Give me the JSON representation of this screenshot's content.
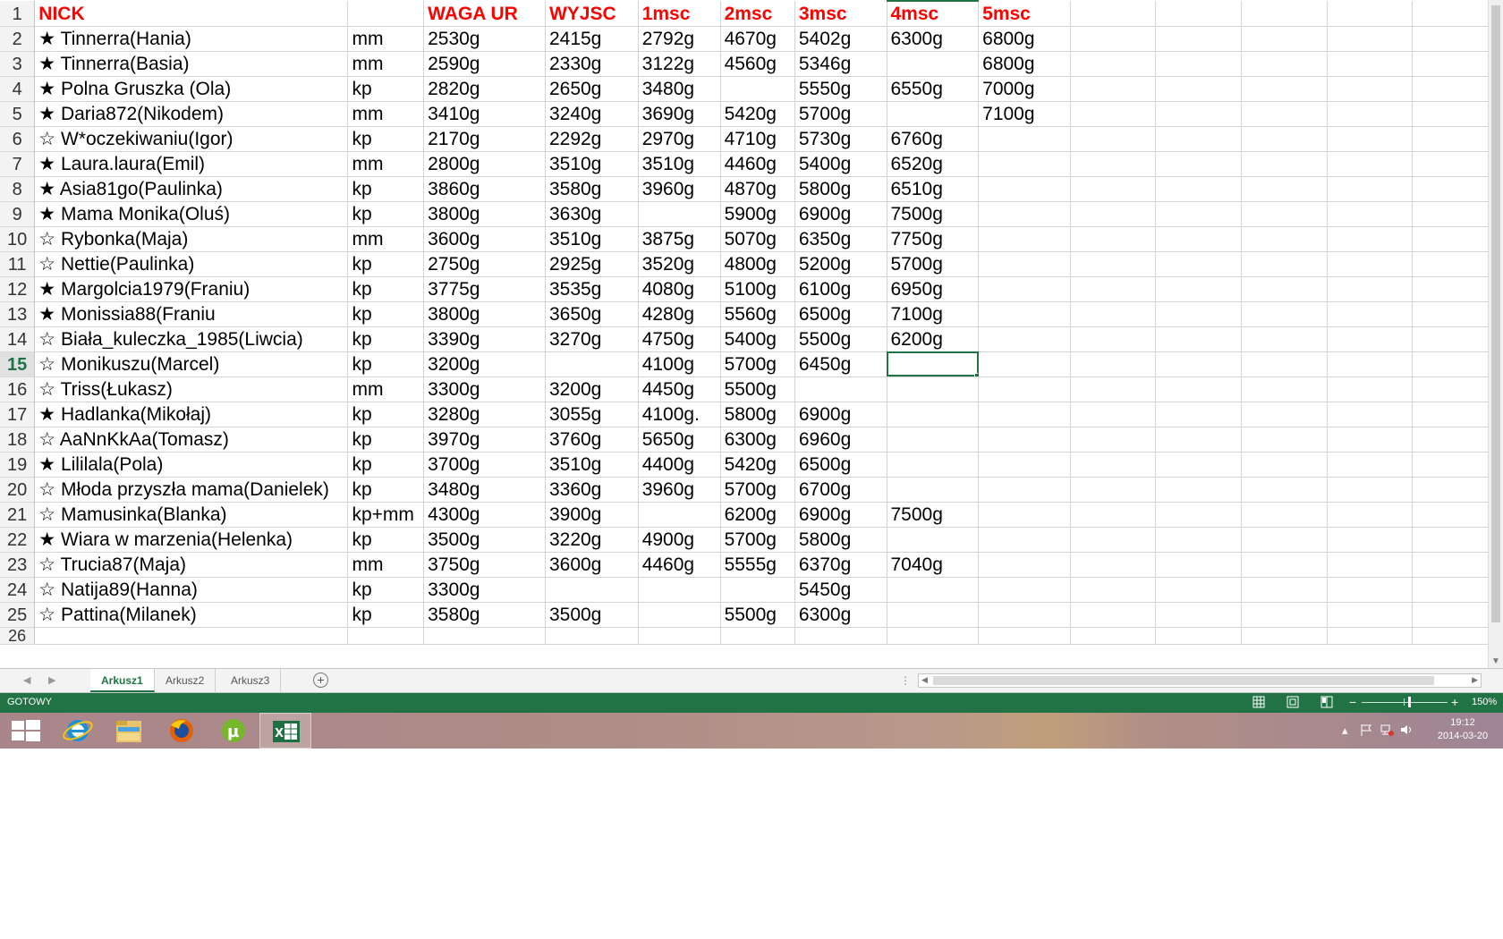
{
  "spreadsheet": {
    "header_row": {
      "row_num": "1",
      "cells": [
        "NICK",
        "",
        "WAGA UR",
        "WYJSC",
        " 1msc",
        "2msc",
        "3msc",
        "4msc",
        "5msc"
      ]
    },
    "rows": [
      {
        "row_num": "2",
        "cells": [
          "★ Tinnerra(Hania)",
          "mm",
          "2530g",
          "2415g",
          "2792g",
          "4670g",
          "5402g",
          "6300g",
          "6800g"
        ]
      },
      {
        "row_num": "3",
        "cells": [
          "★ Tinnerra(Basia)",
          "mm",
          "2590g",
          "2330g",
          "3122g",
          "4560g",
          "5346g",
          "",
          "6800g"
        ]
      },
      {
        "row_num": "4",
        "cells": [
          "★ Polna Gruszka (Ola)",
          "kp",
          "2820g",
          "2650g",
          "3480g",
          "",
          "5550g",
          "6550g",
          "7000g"
        ]
      },
      {
        "row_num": "5",
        "cells": [
          "★ Daria872(Nikodem)",
          "mm",
          "3410g",
          "3240g",
          "3690g",
          "5420g",
          "5700g",
          "",
          "7100g"
        ]
      },
      {
        "row_num": "6",
        "cells": [
          "☆ W*oczekiwaniu(Igor)",
          "kp",
          "2170g",
          "2292g",
          "2970g",
          "4710g",
          "5730g",
          "6760g",
          ""
        ]
      },
      {
        "row_num": "7",
        "cells": [
          "★ Laura.laura(Emil)",
          "mm",
          "2800g",
          "3510g",
          "3510g",
          "4460g",
          "5400g",
          "6520g",
          ""
        ]
      },
      {
        "row_num": "8",
        "cells": [
          "★ Asia81go(Paulinka)",
          "kp",
          "3860g",
          "3580g",
          "3960g",
          "4870g",
          "5800g",
          "6510g",
          ""
        ]
      },
      {
        "row_num": "9",
        "cells": [
          "★ Mama Monika(Oluś)",
          "kp",
          "3800g",
          "3630g",
          "",
          "5900g",
          "6900g",
          "7500g",
          ""
        ]
      },
      {
        "row_num": "10",
        "cells": [
          "☆ Rybonka(Maja)",
          "mm",
          "3600g",
          "3510g",
          "3875g",
          "5070g",
          "6350g",
          "7750g",
          ""
        ]
      },
      {
        "row_num": "11",
        "cells": [
          "☆ Nettie(Paulinka)",
          "kp",
          "2750g",
          "2925g",
          "3520g",
          "4800g",
          "5200g",
          "5700g",
          ""
        ]
      },
      {
        "row_num": "12",
        "cells": [
          "★ Margolcia1979(Franiu)",
          "kp",
          "3775g",
          "3535g",
          "4080g",
          "5100g",
          "6100g",
          "6950g",
          ""
        ]
      },
      {
        "row_num": "13",
        "cells": [
          "★ Monissia88(Franiu",
          "kp",
          "3800g",
          "3650g",
          "4280g",
          "5560g",
          "6500g",
          "7100g",
          ""
        ]
      },
      {
        "row_num": "14",
        "cells": [
          "☆ Biała_kuleczka_1985(Liwcia)",
          "kp",
          "3390g",
          "3270g",
          "4750g",
          "5400g",
          "5500g",
          "6200g",
          ""
        ]
      },
      {
        "row_num": "15",
        "cells": [
          "☆ Monikuszu(Marcel)",
          "kp",
          "3200g",
          "",
          "4100g",
          "5700g",
          "6450g",
          "",
          ""
        ]
      },
      {
        "row_num": "16",
        "cells": [
          "☆ Triss(Łukasz)",
          "mm",
          "3300g",
          "3200g",
          "4450g",
          "5500g",
          "",
          "",
          ""
        ]
      },
      {
        "row_num": "17",
        "cells": [
          "★ Hadlanka(Mikołaj)",
          "kp",
          "3280g",
          "3055g",
          "4100g.",
          "5800g",
          "6900g",
          "",
          ""
        ]
      },
      {
        "row_num": "18",
        "cells": [
          "☆ AaNnKkAa(Tomasz)",
          "kp",
          "3970g",
          "3760g",
          "5650g",
          "6300g",
          "6960g",
          "",
          ""
        ]
      },
      {
        "row_num": "19",
        "cells": [
          "★ Lililala(Pola)",
          "kp",
          "3700g",
          "3510g",
          "4400g",
          "5420g",
          "6500g",
          "",
          ""
        ]
      },
      {
        "row_num": "20",
        "cells": [
          "☆ Młoda przyszła mama(Danielek)",
          "kp",
          "3480g",
          "3360g",
          "3960g",
          "5700g",
          "6700g",
          "",
          ""
        ]
      },
      {
        "row_num": "21",
        "cells": [
          "☆ Mamusinka(Blanka)",
          "kp+mm",
          "4300g",
          "3900g",
          "",
          "6200g",
          "6900g",
          "7500g",
          ""
        ]
      },
      {
        "row_num": "22",
        "cells": [
          "★ Wiara w marzenia(Helenka)",
          "kp",
          "3500g",
          "3220g",
          "4900g",
          "5700g",
          "5800g",
          "",
          ""
        ]
      },
      {
        "row_num": "23",
        "cells": [
          "☆ Trucia87(Maja)",
          "mm",
          "3750g",
          "3600g",
          "4460g",
          "5555g",
          "6370g",
          "7040g",
          ""
        ]
      },
      {
        "row_num": "24",
        "cells": [
          "☆ Natija89(Hanna)",
          "kp",
          "3300g",
          "",
          "",
          "",
          "5450g",
          "",
          ""
        ]
      },
      {
        "row_num": "25",
        "cells": [
          "☆ Pattina(Milanek)",
          "kp",
          "3580g",
          "3500g",
          "",
          "5500g",
          "6300g",
          "",
          ""
        ]
      }
    ],
    "partial_row_num": "26",
    "active_row_num": "15",
    "header_text_color": "#ff0000",
    "accent_color": "#217346"
  },
  "sheet_tabs": {
    "tabs": [
      {
        "label": "Arkusz1",
        "active": true
      },
      {
        "label": "Arkusz2",
        "active": false
      },
      {
        "label": "Arkusz3",
        "active": false
      }
    ],
    "add_icon": "plus-circle-icon"
  },
  "status_bar": {
    "status": "GOTOWY",
    "zoom": "150%",
    "view_icons": [
      "normal-view-icon",
      "page-layout-icon",
      "page-break-preview-icon"
    ]
  },
  "taskbar": {
    "apps": [
      "windows-start-icon",
      "internet-explorer-icon",
      "file-explorer-icon",
      "firefox-icon",
      "utorrent-icon",
      "excel-icon"
    ],
    "active_app": "excel-icon",
    "tray_icons": [
      "show-hidden-icons-icon",
      "action-center-flag-icon",
      "network-icon",
      "volume-icon"
    ],
    "time": "19:12",
    "date": "2014-03-20"
  }
}
